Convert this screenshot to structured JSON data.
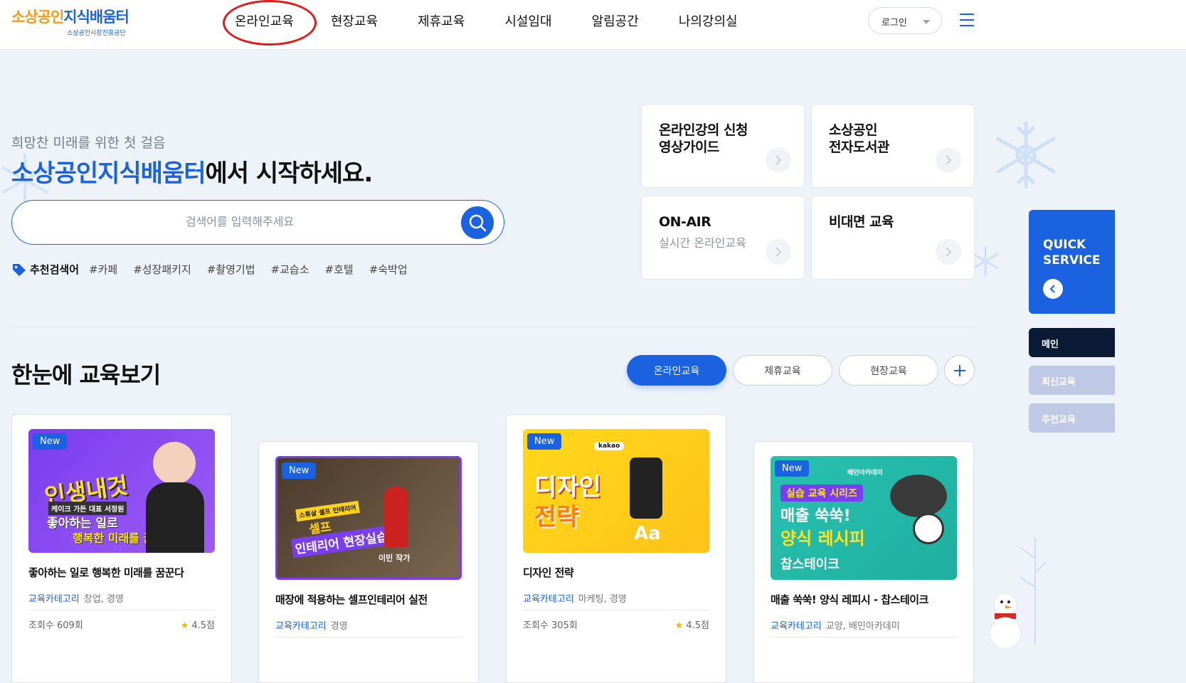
{
  "header": {
    "logo_main_a": "소상공인",
    "logo_main_b": "지식배움터",
    "logo_sub": "소상공인시장진흥공단",
    "nav": [
      "온라인교육",
      "현장교육",
      "제휴교육",
      "시설임대",
      "알림공간",
      "나의강의실"
    ],
    "login_label": "로그인"
  },
  "hero": {
    "subtitle": "희망찬 미래를 위한 첫 걸음",
    "title_blue": "소상공인지식배움터",
    "title_rest": "에서 시작하세요.",
    "search_placeholder": "검색어를 입력해주세요",
    "tag_label": "추천검색어",
    "tags": [
      "#카페",
      "#성장패키지",
      "#촬영기법",
      "#교습소",
      "#호텔",
      "#숙박업"
    ]
  },
  "quick_cards": [
    {
      "title": "온라인강의 신청\n영상가이드",
      "sub": ""
    },
    {
      "title": "소상공인\n전자도서관",
      "sub": ""
    },
    {
      "title": "ON-AIR",
      "sub": "실시간 온라인교육"
    },
    {
      "title": "비대면 교육",
      "sub": ""
    }
  ],
  "quick_service": {
    "label": "QUICK\nSERVICE",
    "menu": [
      "메인",
      "최신교육",
      "추천교육"
    ]
  },
  "section": {
    "title": "한눈에 교육보기",
    "filters": [
      "온라인교육",
      "제휴교육",
      "현장교육"
    ]
  },
  "courses": [
    {
      "badge": "New",
      "thumb_lines": [
        "인생내것",
        "케이크 가든 대표 서정원",
        "좋아하는 일로",
        "행복한 미래를 꿈꾼다"
      ],
      "title": "좋아하는 일로 행복한 미래를 꿈꾼다",
      "category_label": "교육카테고리",
      "category": "창업, 경영",
      "views": "조회수 609회",
      "rating": "4.5점"
    },
    {
      "badge": "New",
      "thumb_lines": [
        "스튜살 셀프 인테리어",
        "셀프",
        "인테리어 현장실습",
        "이민 작가"
      ],
      "title": "매장에 적용하는 셀프인테리어 실전",
      "category_label": "교육카테고리",
      "category": "경영",
      "views": "",
      "rating": ""
    },
    {
      "badge": "New",
      "thumb_lines": [
        "kakao",
        "디자인",
        "전략",
        "Aa"
      ],
      "title": "디자인 전략",
      "category_label": "교육카테고리",
      "category": "마케팅, 경영",
      "views": "조회수 305회",
      "rating": "4.5점"
    },
    {
      "badge": "New",
      "thumb_lines": [
        "배민아카데미",
        "실습 교육 시리즈",
        "매출 쑥쑥!",
        "양식 레시피",
        "찹스테이크"
      ],
      "title": "매출 쑥쑥! 양식 레피시 - 찹스테이크",
      "category_label": "교육카테고리",
      "category": "교양, 배민아카데미",
      "views": "",
      "rating": ""
    }
  ],
  "colors": {
    "primary": "#1a62e0",
    "accent_orange": "#f39b1a",
    "highlight_red": "#e11a1a",
    "bg": "#eef3fa"
  }
}
